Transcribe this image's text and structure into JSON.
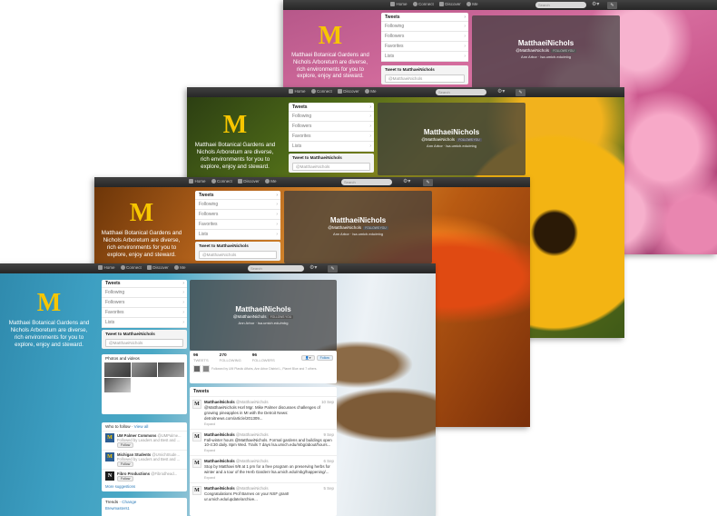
{
  "nav": {
    "home": "Home",
    "connect": "Connect",
    "discover": "Discover",
    "me": "Me",
    "search_placeholder": "Search"
  },
  "profile": {
    "name": "MatthaeiNichols",
    "handle": "@MatthaeiNichols",
    "follows_you": "FOLLOWS YOU",
    "location": "Ann Arbor",
    "url": "lsa.umich.edu/mbg",
    "bio": "Matthaei Botanical Gardens and Nichols Arboretum are diverse, rich environments for you to explore, enjoy and steward.",
    "logo_letter": "M"
  },
  "menu": [
    "Tweets",
    "Following",
    "Followers",
    "Favorites",
    "Lists"
  ],
  "tweet_box": {
    "title": "Tweet to MatthaeiNichols",
    "placeholder": "@MatthaeiNichols"
  },
  "stats": [
    {
      "value": "96",
      "label": "TWEETS"
    },
    {
      "value": "270",
      "label": "FOLLOWING"
    },
    {
      "value": "96",
      "label": "FOLLOWERS"
    }
  ],
  "followed_by": "Followed by UM Plastic Affairs, Ann Arbor District L, Planet Blue and 7 others.",
  "follow_button": "Follow",
  "photos_title": "Photos and videos",
  "who_to_follow": {
    "title": "Who to follow",
    "view_all": "View all",
    "people": [
      {
        "name": "UM Palmer Commons",
        "handle": "@UMPalme...",
        "sub": "Followed by Leaders and Best and ...",
        "avatar": "M"
      },
      {
        "name": "Michigan Students",
        "handle": "@UmichStude...",
        "sub": "Followed by Leaders and Best and ...",
        "avatar": "M"
      },
      {
        "name": "Fibro Productions",
        "handle": "@Fibrodhead...",
        "sub": "",
        "avatar": "N"
      }
    ],
    "more": "More suggestions"
  },
  "trends": {
    "title": "Trends",
    "change": "Change",
    "first": "Brewmasters1"
  },
  "tweets_title": "Tweets",
  "tweets": [
    {
      "user": "MatthaeiNichols",
      "handle": "@MatthaeiNichols",
      "date": "10 Sep",
      "text": "@MatthaeiNichols Horl Mgr. Mike Palmer discusses challenges of growing pineapples in MI with the Detroit News: detroitnews.com/article/201309...",
      "action": "Expand"
    },
    {
      "user": "MatthaeiNichols",
      "handle": "@MatthaeiNichols",
      "date": "9 Sep",
      "text": "Fall-winter hours @MatthaeiNichols. Formal gardens and buildings open 10-4:30 daily. 8pm Wed. Trails 7 days lsa.umich.edu/mbg/about/hours...",
      "action": "Expand"
    },
    {
      "user": "MatthaeiNichols",
      "handle": "@MatthaeiNichols",
      "date": "6 Sep",
      "text": "Stop by Matthaei 9/8 at 1 pm for a free program on preserving herbs for winter and a tour of the Herb Garden! lsa.umich.edu/mbg/happening/...",
      "action": "Expand"
    },
    {
      "user": "MatthaeiNichols",
      "handle": "@MatthaeiNichols",
      "date": "5 Sep",
      "text": "Congratulations Prof Barnes on your NSF grant! ur.umich.edu/update/archive...",
      "action": ""
    }
  ]
}
